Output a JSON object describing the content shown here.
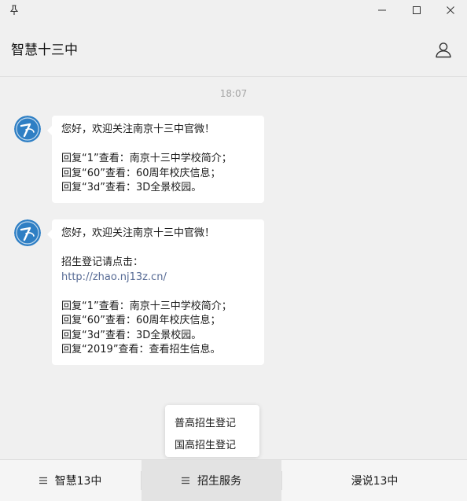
{
  "window": {
    "title": "智慧十三中",
    "controls": {
      "pin": "pin-icon",
      "minimize": "minimize-icon",
      "maximize": "maximize-icon",
      "close": "close-icon"
    }
  },
  "header": {
    "title": "智慧十三中",
    "profile_icon": "user-icon"
  },
  "chat": {
    "timestamp": "18:07",
    "messages": [
      {
        "lines": [
          "您好，欢迎关注南京十三中官微！",
          "",
          "回复“1”查看：南京十三中学校简介；",
          "回复“60”查看：60周年校庆信息；",
          "回复“3d”查看：3D全景校园。"
        ]
      },
      {
        "lines": [
          "您好，欢迎关注南京十三中官微！",
          "",
          "招生登记请点击：",
          "http://zhao.nj13z.cn/",
          "",
          "回复“1”查看：南京十三中学校简介；",
          "回复“60”查看：60周年校庆信息；",
          "回复“3d”查看：3D全景校园。",
          "回复“2019”查看：查看招生信息。"
        ]
      }
    ]
  },
  "popup_menu": {
    "items": [
      "普高招生登记",
      "国高招生登记"
    ]
  },
  "menu_bar": {
    "items": [
      {
        "label": "智慧13中",
        "icon": "menu-lines-icon"
      },
      {
        "label": "招生服务",
        "icon": "menu-lines-icon",
        "active": true
      },
      {
        "label": "漫说13中"
      }
    ]
  },
  "colors": {
    "background": "#f0f0f0",
    "bubble": "#ffffff",
    "link": "#576b95",
    "timestamp": "#a5a5a5",
    "active_menu": "#e3e3e3",
    "avatar": "#2f7fc4"
  }
}
